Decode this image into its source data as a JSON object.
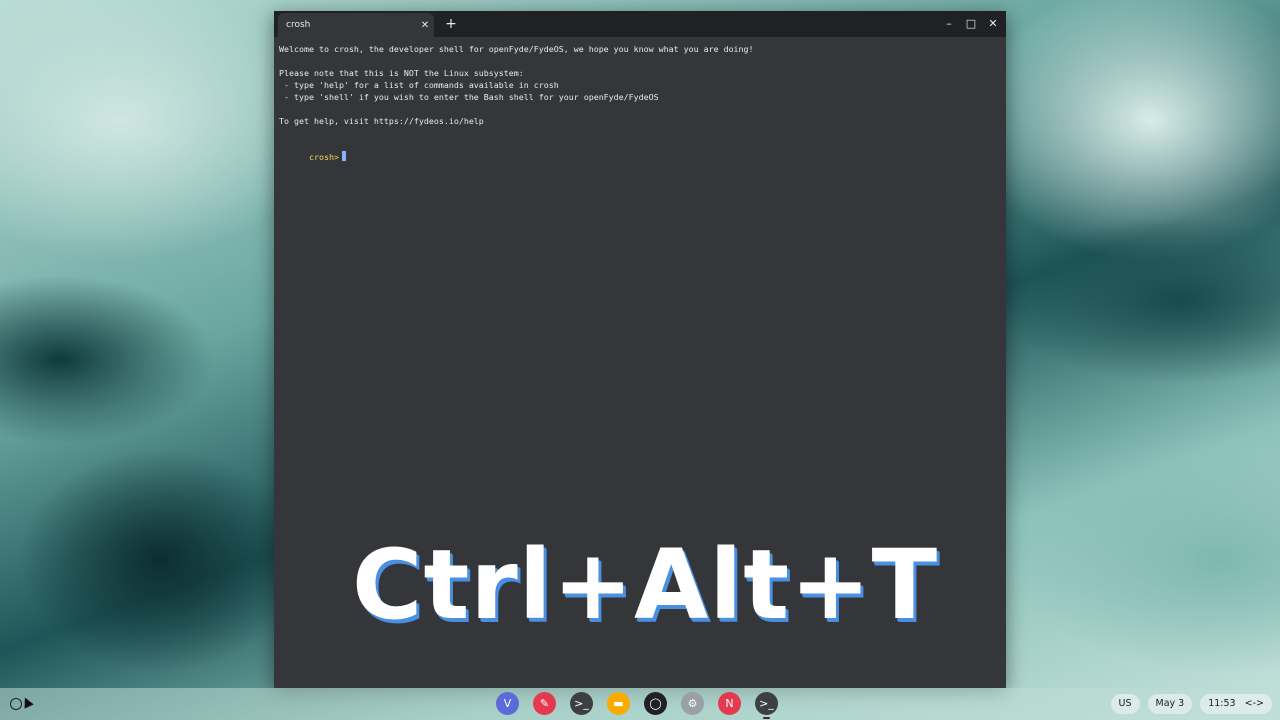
{
  "window": {
    "tab_title": "crosh",
    "tab_close": "✕",
    "new_tab": "+",
    "minimize": "–",
    "maximize": "□",
    "close": "✕"
  },
  "terminal": {
    "lines": [
      "Welcome to crosh, the developer shell for openFyde/FydeOS, we hope you know what you are doing!",
      "",
      "Please note that this is NOT the Linux subsystem:",
      " - type 'help' for a list of commands available in crosh",
      " - type 'shell' if you wish to enter the Bash shell for your openFyde/FydeOS",
      "",
      "To get help, visit https://fydeos.io/help",
      ""
    ],
    "prompt": "crosh>"
  },
  "overlay": {
    "text": "Ctrl+Alt+T"
  },
  "shelf": {
    "apps": [
      {
        "name": "vivaldi-icon",
        "glyph": "V",
        "color": "#5b6bd8"
      },
      {
        "name": "pen-app-icon",
        "glyph": "✎",
        "color": "#e53950"
      },
      {
        "name": "terminal-app-icon",
        "glyph": ">_",
        "color": "#3c4043"
      },
      {
        "name": "files-icon",
        "glyph": "▬",
        "color": "#f9ab00"
      },
      {
        "name": "camera-icon",
        "glyph": "◯",
        "color": "#202124"
      },
      {
        "name": "settings-icon",
        "glyph": "⚙",
        "color": "#9aa0a6"
      },
      {
        "name": "news-app-icon",
        "glyph": "N",
        "color": "#e53950"
      },
      {
        "name": "crosh-app-icon",
        "glyph": ">_",
        "color": "#3c4043"
      }
    ],
    "keyboard_layout": "US",
    "date": "May 3",
    "time": "11:53",
    "network_icon": "<->"
  }
}
